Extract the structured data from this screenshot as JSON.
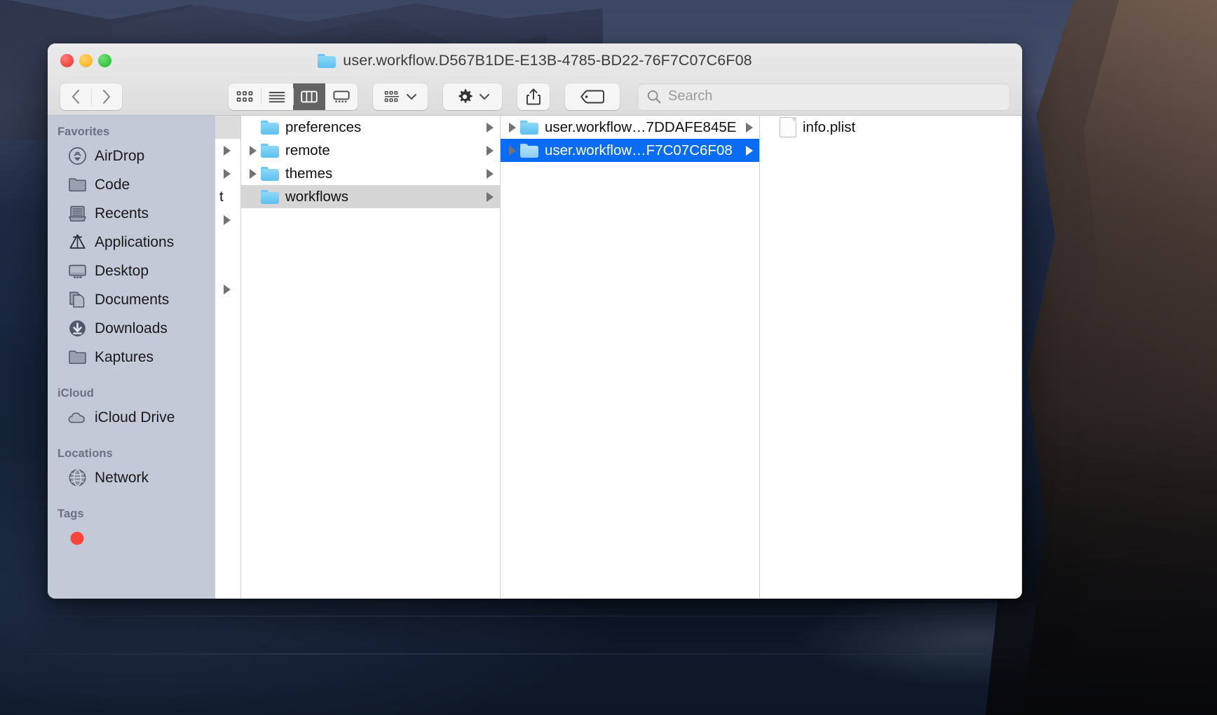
{
  "window": {
    "title": "user.workflow.D567B1DE-E13B-4785-BD22-76F7C07C6F08",
    "title_icon": "folder-icon",
    "traffic_lights": {
      "close": "close-button",
      "minimize": "minimize-button",
      "maximize": "maximize-button"
    }
  },
  "toolbar": {
    "back": "back-button",
    "forward": "forward-button",
    "view_icon": "icon-view-button",
    "view_list": "list-view-button",
    "view_column": "column-view-button",
    "view_gallery": "gallery-view-button",
    "view_active": "column",
    "group": "group-by-button",
    "action": "action-gear-button",
    "share": "share-button",
    "tags": "tags-button"
  },
  "search": {
    "placeholder": "Search",
    "value": "",
    "icon": "search-icon"
  },
  "sidebar": {
    "sections": [
      {
        "header": "Favorites",
        "items": [
          {
            "label": "AirDrop",
            "icon": "airdrop-icon"
          },
          {
            "label": "Code",
            "icon": "folder-icon"
          },
          {
            "label": "Recents",
            "icon": "recents-icon"
          },
          {
            "label": "Applications",
            "icon": "applications-icon"
          },
          {
            "label": "Desktop",
            "icon": "desktop-icon"
          },
          {
            "label": "Documents",
            "icon": "documents-icon"
          },
          {
            "label": "Downloads",
            "icon": "downloads-icon"
          },
          {
            "label": "Kaptures",
            "icon": "folder-icon"
          }
        ]
      },
      {
        "header": "iCloud",
        "items": [
          {
            "label": "iCloud Drive",
            "icon": "icloud-icon"
          }
        ]
      },
      {
        "header": "Locations",
        "items": [
          {
            "label": "Network",
            "icon": "network-globe-icon"
          }
        ]
      },
      {
        "header": "Tags",
        "items": [
          {
            "label": "",
            "icon": "red-tag-icon"
          }
        ]
      }
    ]
  },
  "columns": {
    "partial": {
      "fragment": "t"
    },
    "col2": {
      "rows": [
        {
          "label": "preferences",
          "icon": "folder-icon",
          "has_children": false,
          "selected": false
        },
        {
          "label": "remote",
          "icon": "folder-icon",
          "has_children": true,
          "selected": false
        },
        {
          "label": "themes",
          "icon": "folder-icon",
          "has_children": true,
          "selected": false
        },
        {
          "label": "workflows",
          "icon": "folder-icon",
          "has_children": true,
          "selected": "grey"
        }
      ]
    },
    "col3": {
      "rows": [
        {
          "label": "user.workflow…7DDAFE845E",
          "icon": "folder-icon",
          "has_children": true,
          "selected": false
        },
        {
          "label": "user.workflow…F7C07C6F08",
          "icon": "folder-icon",
          "has_children": true,
          "selected": "blue"
        }
      ]
    },
    "col4": {
      "rows": [
        {
          "label": "info.plist",
          "icon": "document-icon",
          "has_children": false,
          "selected": false
        }
      ]
    }
  },
  "colors": {
    "selection_blue": "#0a6cf5",
    "selection_grey": "#d6d6d6",
    "folder_blue": "#5cc0ef",
    "sidebar_bg": "#c4c9d8",
    "toolbar_bg": "#e4e4e4"
  }
}
